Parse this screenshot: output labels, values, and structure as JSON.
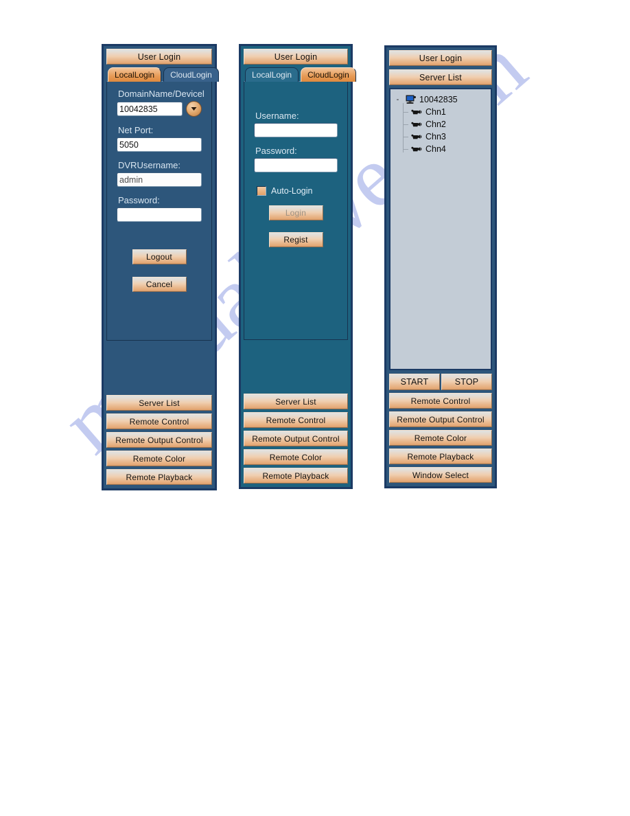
{
  "watermark": {
    "text": "manualslive.com"
  },
  "panels": {
    "local": {
      "header_label": "User Login",
      "tabs": [
        {
          "label": "LocalLogin",
          "active": true
        },
        {
          "label": "CloudLogin",
          "active": false
        }
      ],
      "fields": [
        {
          "label": "DomainName/Devicel",
          "value": "10042835"
        },
        {
          "label": "Net Port:",
          "value": "5050"
        },
        {
          "label": "DVRUsername:",
          "value": "admin"
        },
        {
          "label": "Password:",
          "value": ""
        }
      ],
      "actions": [
        {
          "label": "Logout"
        },
        {
          "label": "Cancel"
        }
      ],
      "bottom_buttons": [
        "Server List",
        "Remote Control",
        "Remote Output Control",
        "Remote Color",
        "Remote Playback"
      ]
    },
    "cloud": {
      "header_label": "User Login",
      "tabs": [
        {
          "label": "LocalLogin",
          "active": false
        },
        {
          "label": "CloudLogin",
          "active": true
        }
      ],
      "fields": [
        {
          "label": "Username:",
          "value": ""
        },
        {
          "label": "Password:",
          "value": ""
        }
      ],
      "auto_login_label": "Auto-Login",
      "actions": [
        {
          "label": "Login",
          "disabled": true
        },
        {
          "label": "Regist",
          "disabled": false
        }
      ],
      "bottom_buttons": [
        "Server List",
        "Remote Control",
        "Remote Output Control",
        "Remote Color",
        "Remote Playback"
      ]
    },
    "server": {
      "header_label": "User Login",
      "serverlist_label": "Server List",
      "tree": {
        "root": {
          "label": "10042835",
          "expander": "-"
        },
        "children": [
          {
            "label": "Chn1"
          },
          {
            "label": "Chn2"
          },
          {
            "label": "Chn3"
          },
          {
            "label": "Chn4"
          }
        ]
      },
      "start_label": "START",
      "stop_label": "STOP",
      "bottom_buttons": [
        "Remote Control",
        "Remote Output Control",
        "Remote Color",
        "Remote Playback",
        "Window Select"
      ]
    }
  },
  "colors": {
    "panel_navy": "#2d567b",
    "panel_teal": "#1d627f",
    "panel_border": "#1b3a64",
    "button_orange": "#e9b98f",
    "tab_active": "#e79a55",
    "tree_bg": "#c3ccd6",
    "watermark": "#b9c2ee"
  }
}
